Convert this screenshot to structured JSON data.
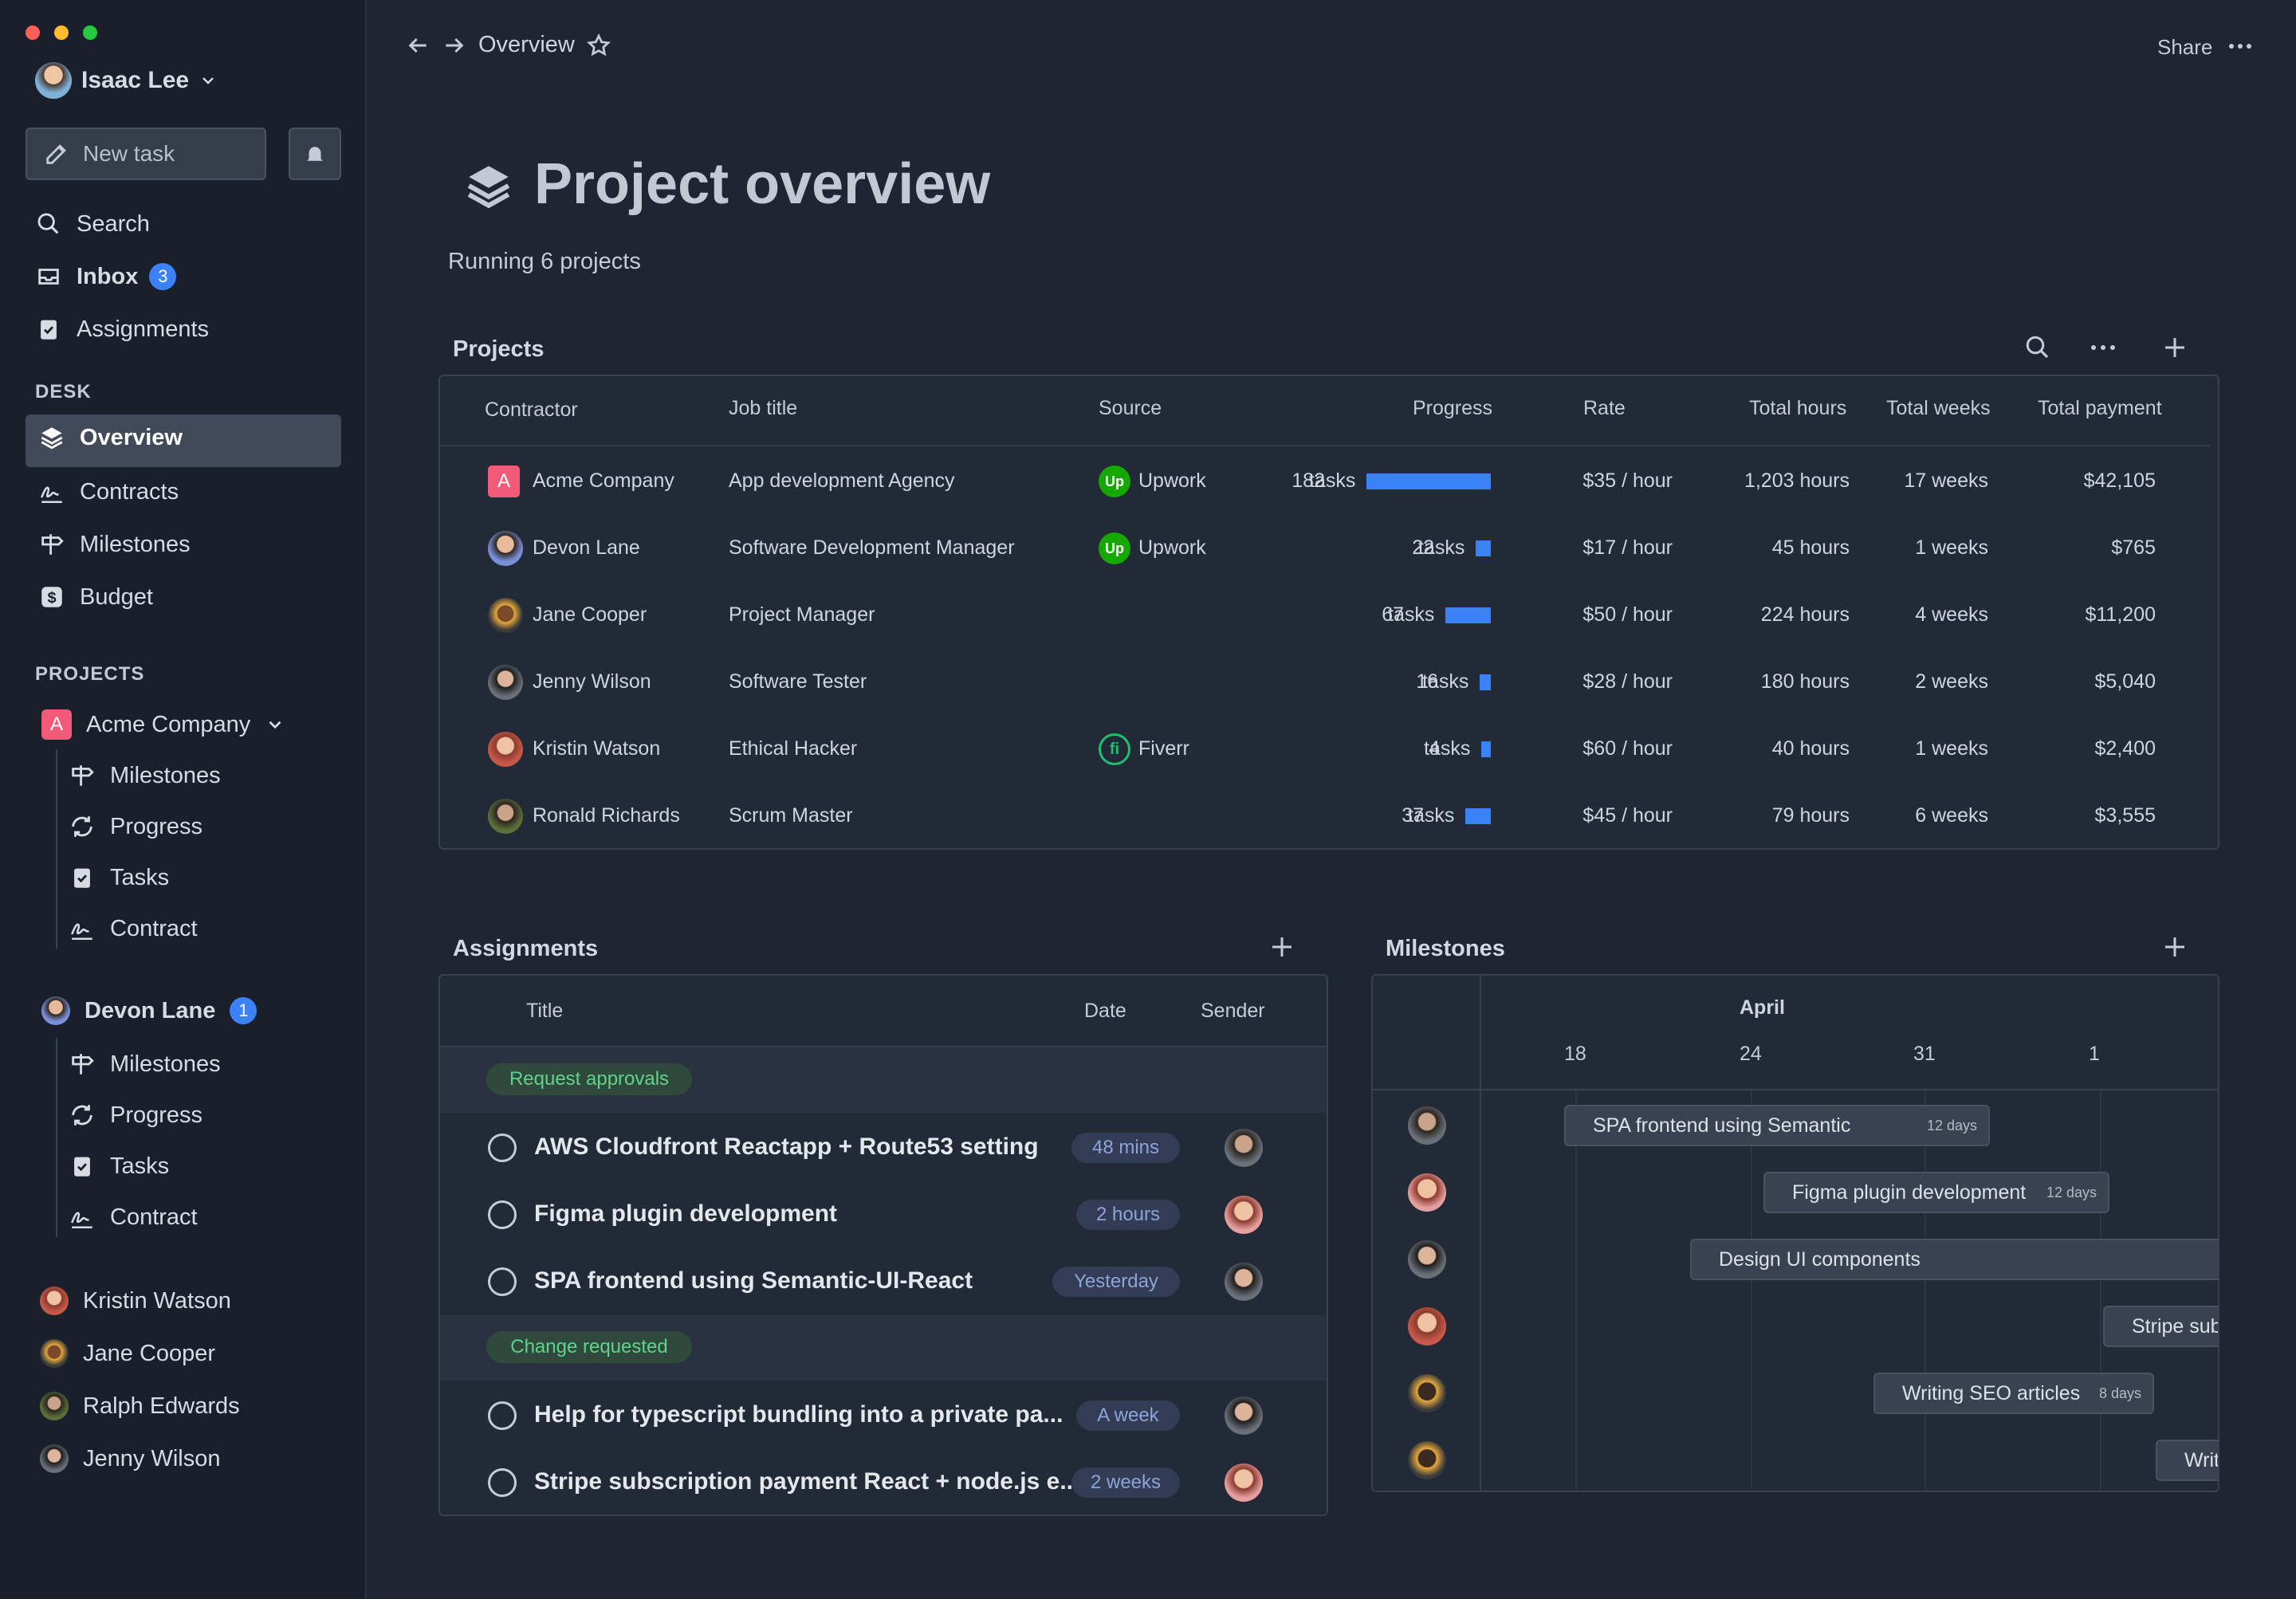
{
  "window": {
    "dot_colors": [
      "#fe5f57",
      "#febc2e",
      "#28c840"
    ]
  },
  "user": {
    "name": "Isaac Lee"
  },
  "sidebar": {
    "new_task_label": "New task",
    "nav": [
      {
        "label": "Search",
        "icon": "search-icon"
      },
      {
        "label": "Inbox",
        "icon": "inbox-icon",
        "badge": "3"
      },
      {
        "label": "Assignments",
        "icon": "clipboard-icon"
      }
    ],
    "desk_label": "DESK",
    "desk": [
      {
        "label": "Overview",
        "icon": "layers-icon"
      },
      {
        "label": "Contracts",
        "icon": "signature-icon"
      },
      {
        "label": "Milestones",
        "icon": "signpost-icon"
      },
      {
        "label": "Budget",
        "icon": "dollar-icon"
      }
    ],
    "projects_label": "PROJECTS",
    "project_acme": {
      "name": "Acme Company",
      "children": [
        "Milestones",
        "Progress",
        "Tasks",
        "Contract"
      ]
    },
    "project_devon": {
      "name": "Devon Lane",
      "badge": "1",
      "children": [
        "Milestones",
        "Progress",
        "Tasks",
        "Contract"
      ]
    },
    "people": [
      "Kristin Watson",
      "Jane Cooper",
      "Ralph Edwards",
      "Jenny Wilson"
    ]
  },
  "topbar": {
    "breadcrumb": "Overview",
    "share_label": "Share"
  },
  "header": {
    "title": "Project overview",
    "subtitle": "Running 6 projects"
  },
  "projects": {
    "title": "Projects",
    "columns": [
      "Contractor",
      "Job title",
      "Source",
      "Progress",
      "Rate",
      "Total hours",
      "Total weeks",
      "Total payment"
    ],
    "rows": [
      {
        "contractor": "Acme Company",
        "job": "App development Agency",
        "source": "Upwork",
        "tasks": "182",
        "tasks_label": "tasks",
        "progress": 182,
        "rate": "$35 / hour",
        "hours": "1,203 hours",
        "weeks": "17 weeks",
        "payment": "$42,105"
      },
      {
        "contractor": "Devon Lane",
        "job": "Software Development Manager",
        "source": "Upwork",
        "tasks": "22",
        "tasks_label": "tasks",
        "progress": 22,
        "rate": "$17 / hour",
        "hours": "45 hours",
        "weeks": "1 weeks",
        "payment": "$765"
      },
      {
        "contractor": "Jane Cooper",
        "job": "Project Manager",
        "source": "",
        "tasks": "67",
        "tasks_label": "tasks",
        "progress": 67,
        "rate": "$50 / hour",
        "hours": "224  hours",
        "weeks": "4 weeks",
        "payment": "$11,200"
      },
      {
        "contractor": "Jenny Wilson",
        "job": "Software Tester",
        "source": "",
        "tasks": "16",
        "tasks_label": "tasks",
        "progress": 16,
        "rate": "$28 / hour",
        "hours": "180  hours",
        "weeks": "2 weeks",
        "payment": "$5,040"
      },
      {
        "contractor": "Kristin Watson",
        "job": "Ethical Hacker",
        "source": "Fiverr",
        "tasks": "4",
        "tasks_label": "tasks",
        "progress": 4,
        "rate": "$60 / hour",
        "hours": "40  hours",
        "weeks": "1 weeks",
        "payment": "$2,400"
      },
      {
        "contractor": "Ronald Richards",
        "job": "Scrum Master",
        "source": "",
        "tasks": "37",
        "tasks_label": "tasks",
        "progress": 37,
        "rate": "$45 / hour",
        "hours": "79 hours",
        "weeks": "6 weeks",
        "payment": "$3,555"
      }
    ]
  },
  "assignments": {
    "title": "Assignments",
    "columns": [
      "Title",
      "Date",
      "Sender"
    ],
    "group1": "Request approvals",
    "group2": "Change requested",
    "items": [
      {
        "title": "AWS Cloudfront Reactapp + Route53 setting",
        "date": "48 mins"
      },
      {
        "title": "Figma plugin development",
        "date": "2 hours"
      },
      {
        "title": "SPA frontend using Semantic-UI-React",
        "date": "Yesterday"
      },
      {
        "title": "Help for typescript bundling into a private pa...",
        "date": "A week"
      },
      {
        "title": "Stripe subscription payment React + node.js e...",
        "date": "2 weeks"
      }
    ]
  },
  "milestones": {
    "title": "Milestones",
    "month": "April",
    "days": [
      "18",
      "24",
      "31",
      "1"
    ],
    "bars": [
      {
        "label": "SPA frontend using Semantic",
        "days": "12 days"
      },
      {
        "label": "Figma plugin development",
        "days": "12 days"
      },
      {
        "label": "Design UI components",
        "days": ""
      },
      {
        "label": "Stripe sub",
        "days": ""
      },
      {
        "label": "Writing SEO articles",
        "days": "8 days"
      },
      {
        "label": "Writ",
        "days": ""
      }
    ]
  },
  "colors": {
    "accent": "#3b82f6",
    "upwork": "#14a800",
    "fiverr": "#1dbf73",
    "acme": "#f25a7a",
    "status_green": "#4ade80"
  }
}
